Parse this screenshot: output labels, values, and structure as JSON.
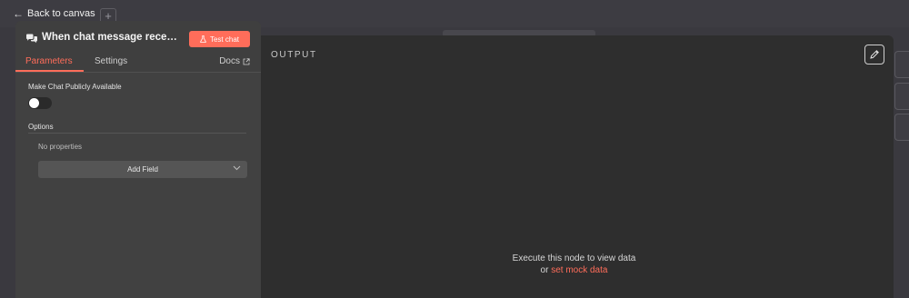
{
  "nav": {
    "back_label": "Back to canvas",
    "plus_symbol": "+"
  },
  "node": {
    "title": "When chat message recei...",
    "icon": "chat-bubbles-icon",
    "test_button_label": "Test chat",
    "test_button_icon": "flask-icon",
    "accent_color": "#ff6d5a"
  },
  "tabs": {
    "parameters": "Parameters",
    "settings": "Settings",
    "docs": "Docs",
    "active": "Parameters"
  },
  "params": {
    "public_label": "Make Chat Publicly Available",
    "public_enabled": false,
    "options_label": "Options",
    "no_properties": "No properties",
    "add_field_label": "Add Field"
  },
  "output": {
    "heading": "OUTPUT",
    "empty_line1": "Execute this node to view data",
    "empty_or": "or",
    "mock_link": "set mock data"
  }
}
